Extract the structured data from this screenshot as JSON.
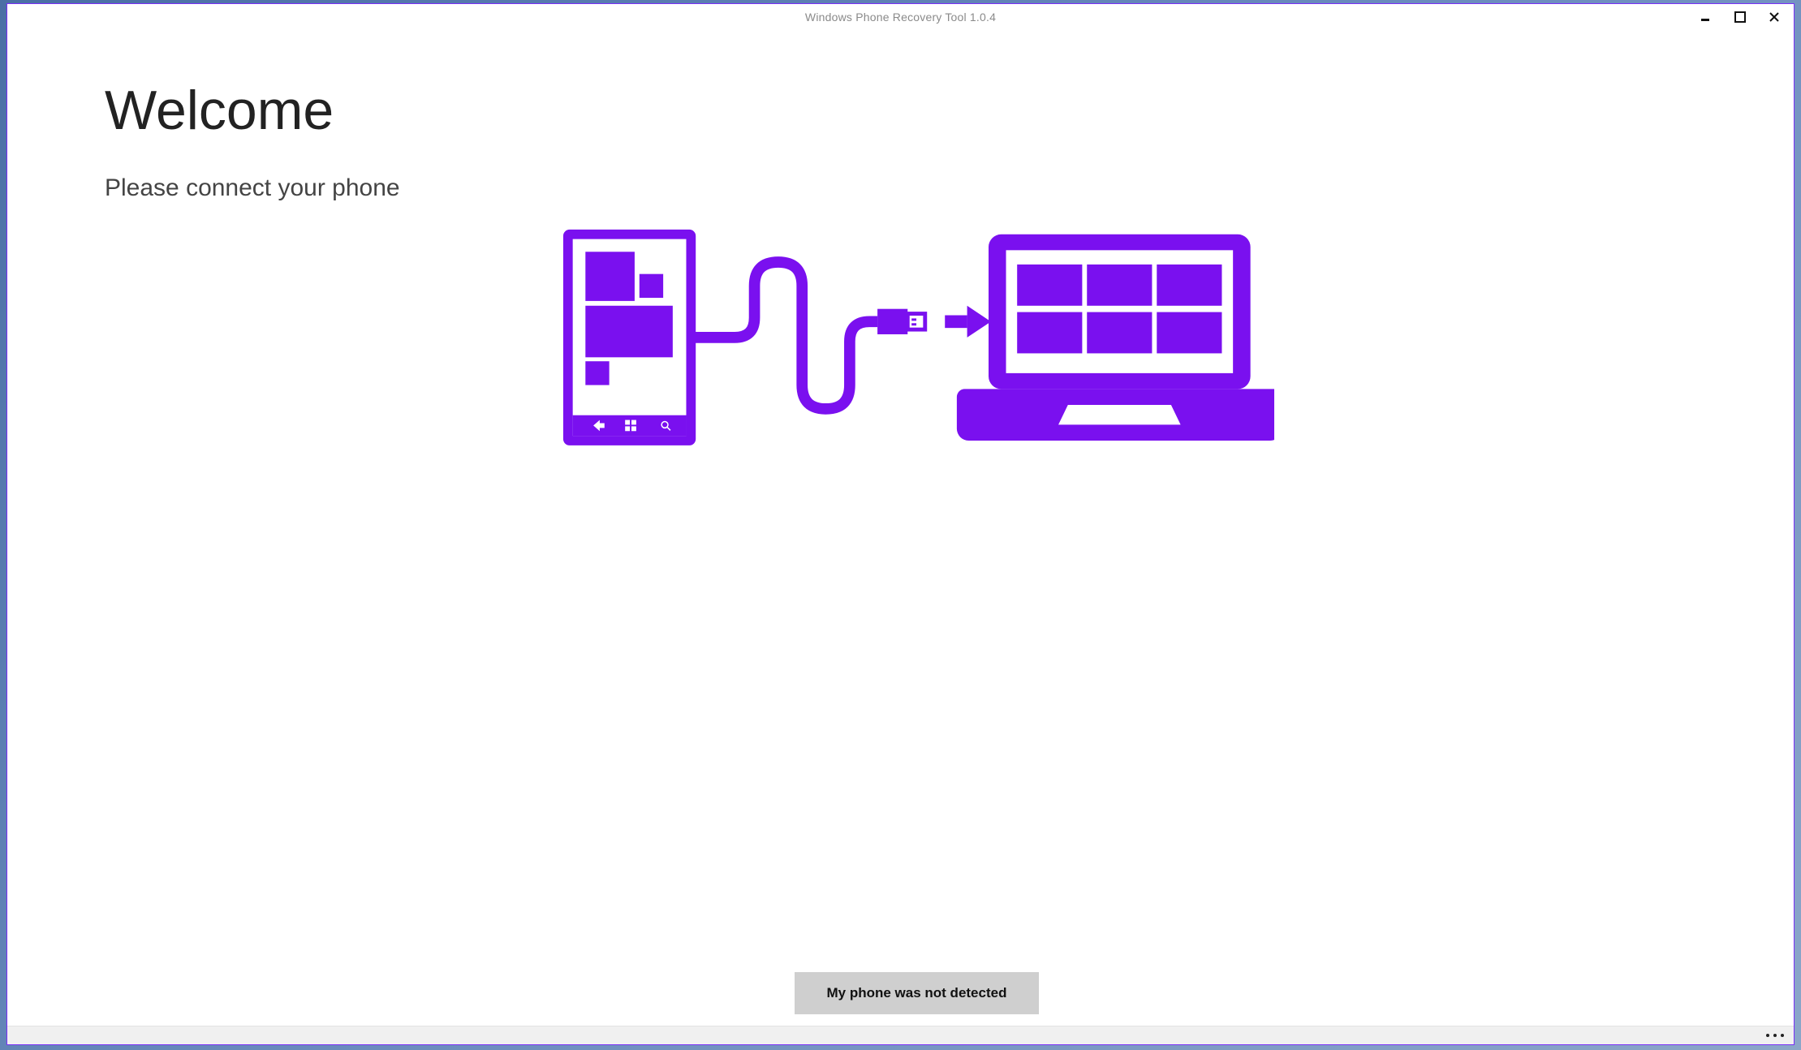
{
  "window": {
    "title": "Windows Phone Recovery Tool 1.0.4"
  },
  "page": {
    "heading": "Welcome",
    "subheading": "Please connect your phone"
  },
  "buttons": {
    "notDetected": "My phone was not detected"
  },
  "colors": {
    "accent": "#7a10ef"
  }
}
